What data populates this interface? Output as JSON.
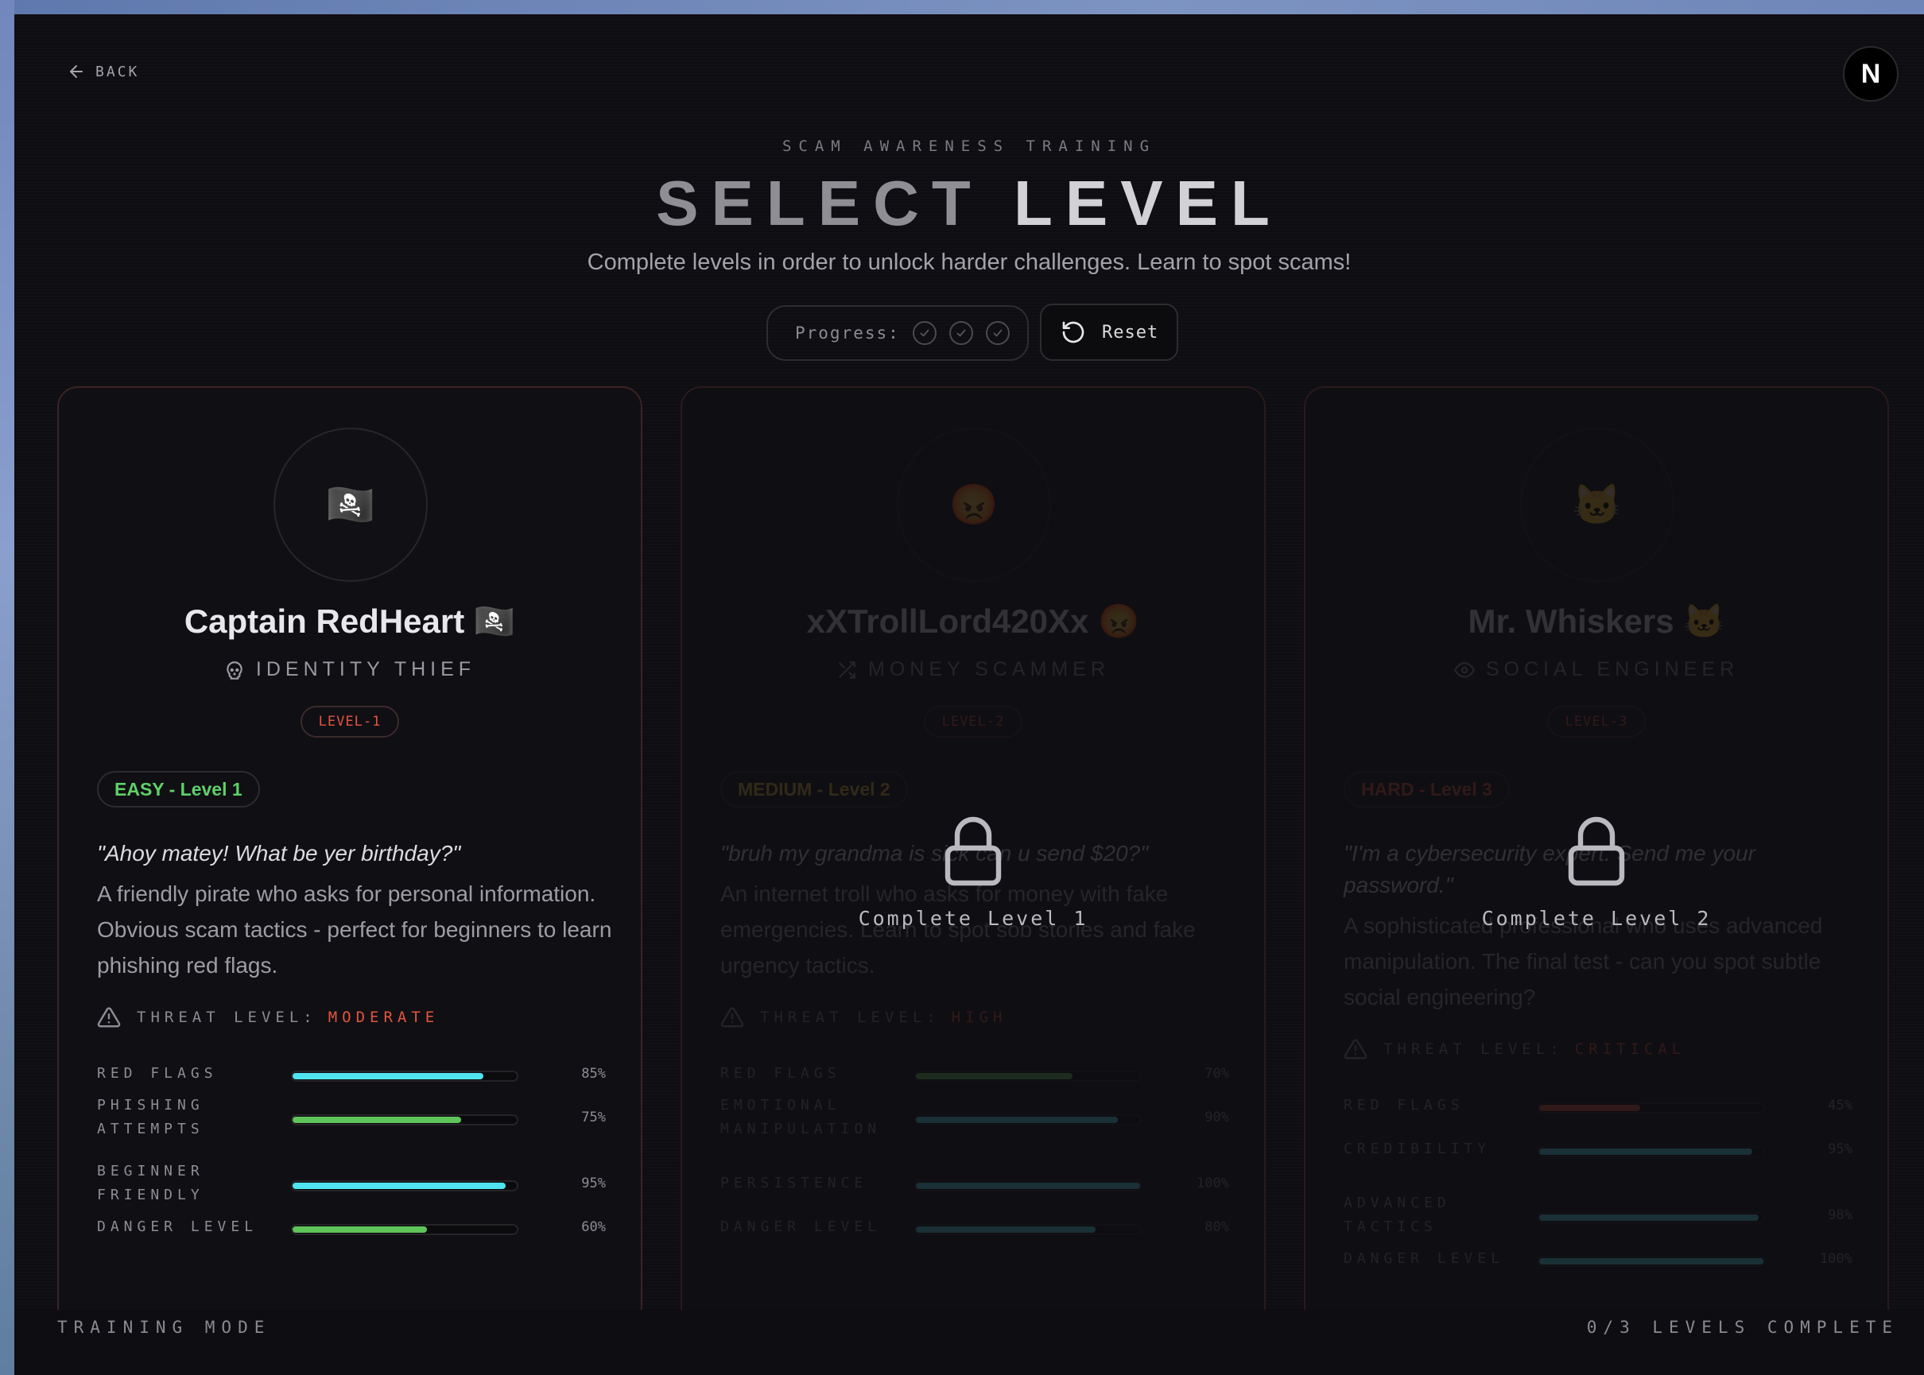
{
  "header": {
    "back_label": "BACK",
    "logo_letter": "N",
    "eyebrow": "SCAM AWARENESS TRAINING",
    "title_word1": "SELECT",
    "title_word2": "LEVEL",
    "subtitle": "Complete levels in order to unlock harder challenges. Learn to spot scams!"
  },
  "progress": {
    "label": "Progress:",
    "completed": 0,
    "total": 3,
    "reset_label": "Reset"
  },
  "levels": [
    {
      "emoji": "🏴‍☠️",
      "name": "Captain RedHeart 🏴‍☠️",
      "role": "IDENTITY THIEF",
      "role_icon": "skull-icon",
      "tag": "LEVEL-1",
      "difficulty": "EASY - Level 1",
      "difficulty_color": "#5fd068",
      "quote": "\"Ahoy matey! What be yer birthday?\"",
      "description": "A friendly pirate who asks for personal information. Obvious scam tactics - perfect for beginners to learn phishing red flags.",
      "threat_label": "THREAT LEVEL:",
      "threat_value": "MODERATE",
      "threat_color": "#e2553f",
      "locked": false,
      "lock_text": "",
      "stats": [
        {
          "label": "RED FLAGS",
          "value": 85,
          "value_label": "85%",
          "color": "#4fe3ee"
        },
        {
          "label": "PHISHING ATTEMPTS",
          "value": 75,
          "value_label": "75%",
          "color": "#5fc45a"
        },
        {
          "label": "BEGINNER FRIENDLY",
          "value": 95,
          "value_label": "95%",
          "color": "#4fe3ee"
        },
        {
          "label": "DANGER LEVEL",
          "value": 60,
          "value_label": "60%",
          "color": "#5fc45a"
        }
      ]
    },
    {
      "emoji": "😡",
      "name": "xXTrollLord420Xx 😡",
      "role": "MONEY SCAMMER",
      "role_icon": "shuffle-icon",
      "tag": "LEVEL-2",
      "difficulty": "MEDIUM - Level 2",
      "difficulty_color": "#e0b53a",
      "quote": "\"bruh my grandma is sick can u send $20?\"",
      "description": "An internet troll who asks for money with fake emergencies. Learn to spot sob stories and fake urgency tactics.",
      "threat_label": "THREAT LEVEL:",
      "threat_value": "HIGH",
      "threat_color": "#e2553f",
      "locked": true,
      "lock_text": "Complete Level 1",
      "stats": [
        {
          "label": "RED FLAGS",
          "value": 70,
          "value_label": "70%",
          "color": "#5fc45a"
        },
        {
          "label": "EMOTIONAL MANIPULATION",
          "value": 90,
          "value_label": "90%",
          "color": "#4fe3ee"
        },
        {
          "label": "PERSISTENCE",
          "value": 100,
          "value_label": "100%",
          "color": "#4fe3ee"
        },
        {
          "label": "DANGER LEVEL",
          "value": 80,
          "value_label": "80%",
          "color": "#4fe3ee"
        }
      ]
    },
    {
      "emoji": "🐱",
      "name": "Mr. Whiskers 🐱",
      "role": "SOCIAL ENGINEER",
      "role_icon": "eye-icon",
      "tag": "LEVEL-3",
      "difficulty": "HARD - Level 3",
      "difficulty_color": "#e2553f",
      "quote": "\"I'm a cybersecurity expert. Send me your password.\"",
      "description": "A sophisticated professional who uses advanced manipulation. The final test - can you spot subtle social engineering?",
      "threat_label": "THREAT LEVEL:",
      "threat_value": "CRITICAL",
      "threat_color": "#e2553f",
      "locked": true,
      "lock_text": "Complete Level 2",
      "stats": [
        {
          "label": "RED FLAGS",
          "value": 45,
          "value_label": "45%",
          "color": "#e2553f"
        },
        {
          "label": "CREDIBILITY",
          "value": 95,
          "value_label": "95%",
          "color": "#4fe3ee"
        },
        {
          "label": "ADVANCED TACTICS",
          "value": 98,
          "value_label": "98%",
          "color": "#4fe3ee"
        },
        {
          "label": "DANGER LEVEL",
          "value": 100,
          "value_label": "100%",
          "color": "#4fe3ee"
        }
      ]
    }
  ],
  "footer": {
    "left": "TRAINING MODE",
    "right": "0/3 LEVELS COMPLETE"
  }
}
